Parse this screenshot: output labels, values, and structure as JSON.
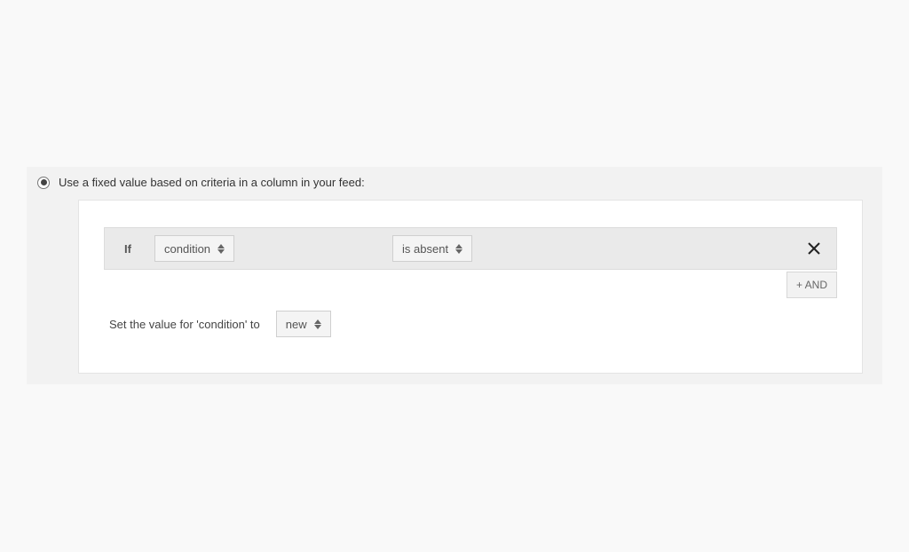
{
  "option": {
    "label": "Use a fixed value based on criteria in a column in your feed:"
  },
  "rule": {
    "if_label": "If",
    "field": "condition",
    "operator": "is absent",
    "and_button": "+ AND",
    "set_prefix": "Set the value for '",
    "set_field": "condition",
    "set_suffix": "' to",
    "set_value": "new"
  }
}
